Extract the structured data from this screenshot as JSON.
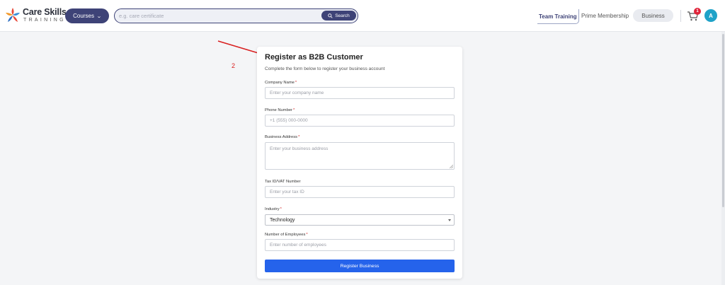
{
  "brand": {
    "title": "Care Skills",
    "subtitle": "TRAINING"
  },
  "header": {
    "courses_label": "Courses",
    "search": {
      "placeholder": "e.g. care certificate",
      "value": "",
      "button_label": "Search"
    },
    "nav": {
      "team_training": "Team Training",
      "prime_membership": "Prime Membership",
      "business": "Business"
    },
    "cart_count": "1",
    "avatar_initial": "A"
  },
  "annotation": {
    "number": "2"
  },
  "form": {
    "title": "Register as B2B Customer",
    "subtitle": "Complete the form below to register your business account",
    "required_mark": "*",
    "fields": {
      "company_name": {
        "label": "Company Name",
        "placeholder": "Enter your company name"
      },
      "phone": {
        "label": "Phone Number",
        "placeholder": "+1 (555) 000-0000"
      },
      "address": {
        "label": "Business Address",
        "placeholder": "Enter your business address"
      },
      "tax_id": {
        "label": "Tax ID/VAT Number",
        "placeholder": "Enter your tax ID"
      },
      "industry": {
        "label": "Industry",
        "selected": "Technology"
      },
      "employees": {
        "label": "Number of Employees",
        "placeholder": "Enter number of employees"
      }
    },
    "submit_label": "Register Business"
  },
  "colors": {
    "brand_navy": "#3e4377",
    "primary_blue": "#2563eb",
    "badge_red": "#e0243a",
    "avatar_teal": "#1fa2c8",
    "annotation_red": "#d92020"
  }
}
